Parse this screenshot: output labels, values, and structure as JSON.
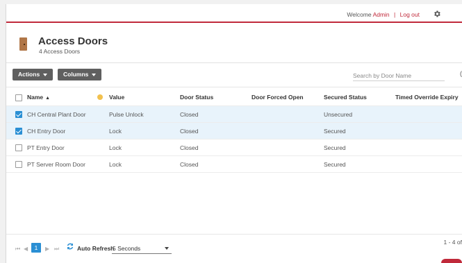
{
  "topbar": {
    "welcome_prefix": "Welcome",
    "user": "Admin",
    "separator": "|",
    "logout": "Log out"
  },
  "header": {
    "title": "Access Doors",
    "subtitle": "4 Access Doors"
  },
  "toolbar": {
    "actions_label": "Actions",
    "columns_label": "Columns",
    "search_placeholder": "Search by Door Name"
  },
  "table": {
    "columns": {
      "name": "Name",
      "value": "Value",
      "door_status": "Door Status",
      "door_forced_open": "Door Forced Open",
      "secured_status": "Secured Status",
      "timed_override_expiry": "Timed Override Expiry"
    },
    "rows": [
      {
        "name": "CH Central Plant Door",
        "value": "Pulse Unlock",
        "door_status": "Closed",
        "door_forced_open": "",
        "secured_status": "Unsecured",
        "timed_override_expiry": "",
        "selected": true
      },
      {
        "name": "CH Entry Door",
        "value": "Lock",
        "door_status": "Closed",
        "door_forced_open": "",
        "secured_status": "Secured",
        "timed_override_expiry": "",
        "selected": true
      },
      {
        "name": "PT Entry Door",
        "value": "Lock",
        "door_status": "Closed",
        "door_forced_open": "",
        "secured_status": "Secured",
        "timed_override_expiry": "",
        "selected": false
      },
      {
        "name": "PT Server Room Door",
        "value": "Lock",
        "door_status": "Closed",
        "door_forced_open": "",
        "secured_status": "Secured",
        "timed_override_expiry": "",
        "selected": false
      }
    ]
  },
  "footer": {
    "current_page": "1",
    "auto_refresh_label": "Auto Refresh",
    "interval": "5 Seconds",
    "range": "1 - 4 of"
  },
  "colors": {
    "accent": "#c0293a",
    "selection": "#2a8fd4",
    "selected_row": "#e8f3fb"
  },
  "icons": [
    "settings-gear-icon",
    "door-icon",
    "sort-ascending-icon",
    "hand-icon",
    "checkbox-icon",
    "first-page-icon",
    "prev-page-icon",
    "next-page-icon",
    "last-page-icon",
    "refresh-icon",
    "chevron-down-icon"
  ]
}
